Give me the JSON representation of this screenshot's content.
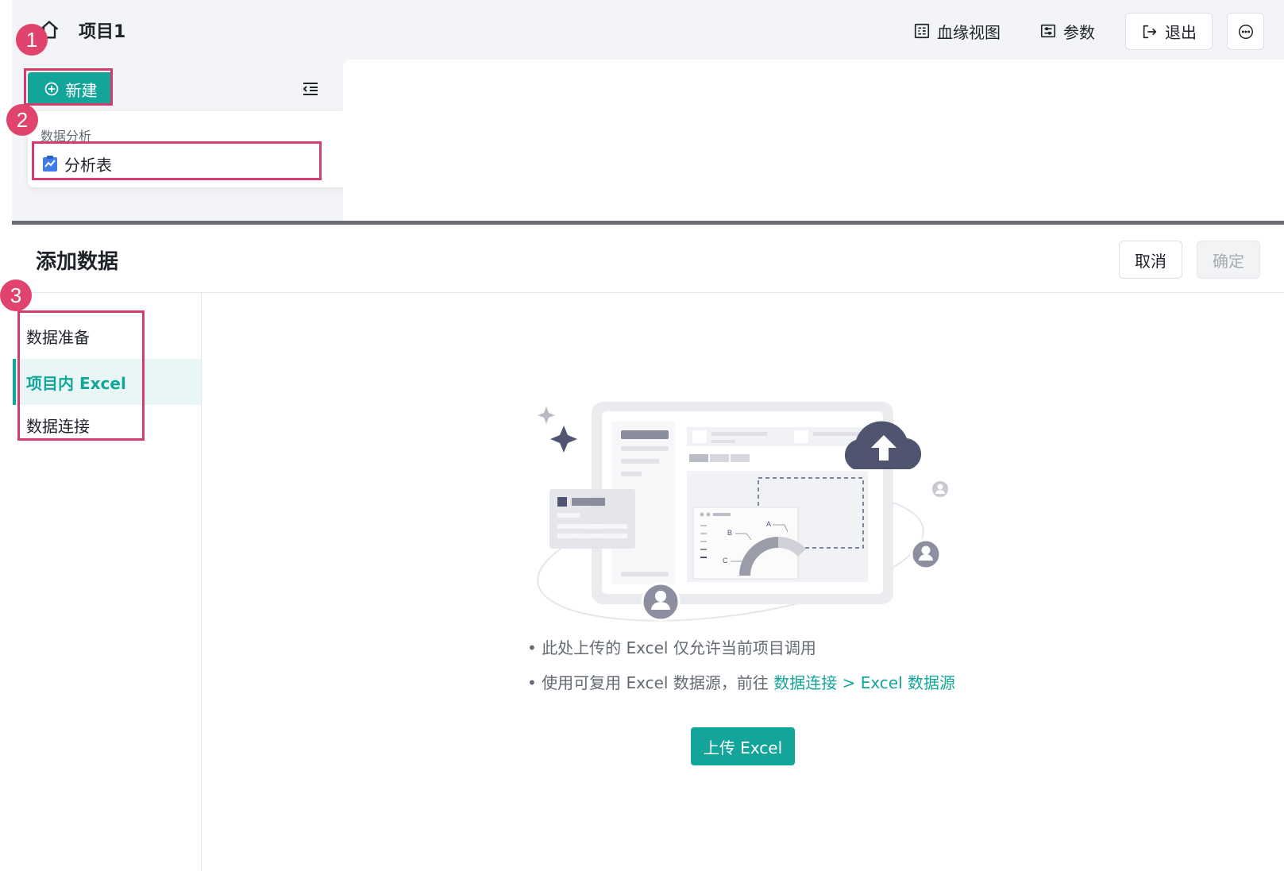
{
  "header": {
    "project_title": "项目1",
    "lineage_label": "血缘视图",
    "params_label": "参数",
    "exit_label": "退出"
  },
  "sidebar": {
    "new_label": "新建",
    "dropdown_group": "数据分析",
    "dropdown_item": "分析表"
  },
  "markers": [
    "1",
    "2",
    "3"
  ],
  "panel": {
    "title": "添加数据",
    "cancel_label": "取消",
    "confirm_label": "确定",
    "nav": [
      {
        "label": "数据准备"
      },
      {
        "label": "项目内 Excel"
      },
      {
        "label": "数据连接"
      }
    ],
    "tip1": "• 此处上传的 Excel 仅允许当前项目调用",
    "tip2_prefix": "• 使用可复用 Excel 数据源，前往 ",
    "tip2_link": "数据连接 > Excel 数据源",
    "upload_label": "上传 Excel",
    "illus_labels": {
      "a": "A",
      "b": "B",
      "c": "C"
    }
  },
  "colors": {
    "accent": "#13a59a",
    "annotation": "#e0436b",
    "header_bg": "#f3f4f8"
  }
}
